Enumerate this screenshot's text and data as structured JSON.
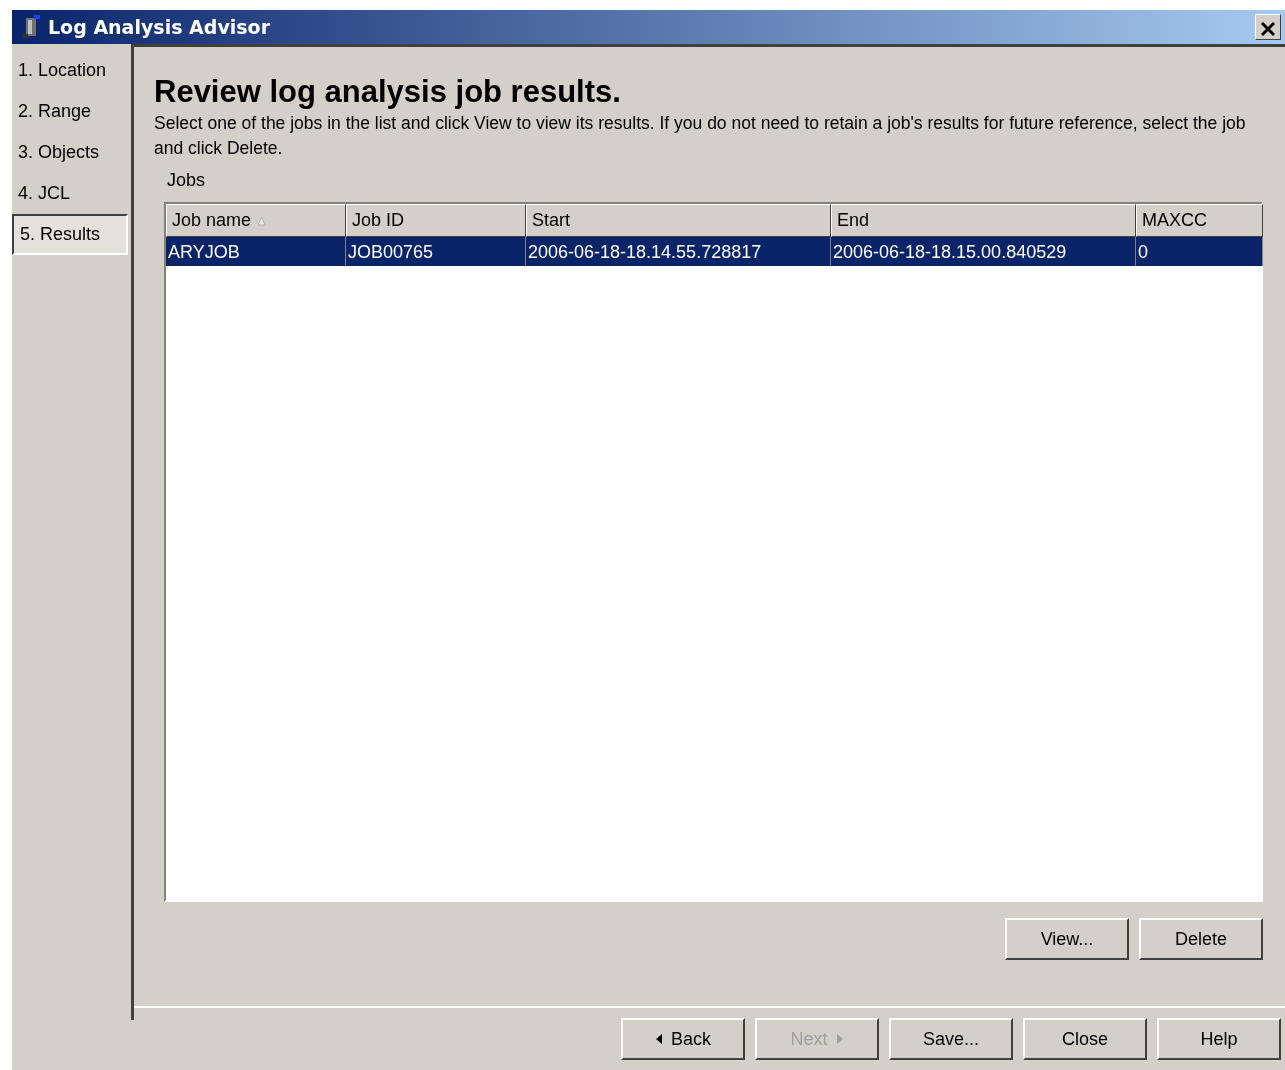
{
  "window": {
    "title": "Log Analysis Advisor"
  },
  "steps": [
    {
      "label": "1. Location",
      "selected": false
    },
    {
      "label": "2. Range",
      "selected": false
    },
    {
      "label": "3. Objects",
      "selected": false
    },
    {
      "label": "4. JCL",
      "selected": false
    },
    {
      "label": "5. Results",
      "selected": true
    }
  ],
  "heading": "Review log analysis job results.",
  "description": "Select one of the jobs in the list and click View to view its results. If you do not need to retain a job's results for future reference, select the job and click Delete.",
  "jobs_label": "Jobs",
  "table": {
    "columns": [
      {
        "label": "Job name",
        "sorted": true
      },
      {
        "label": "Job ID",
        "sorted": false
      },
      {
        "label": "Start",
        "sorted": false
      },
      {
        "label": "End",
        "sorted": false
      },
      {
        "label": "MAXCC",
        "sorted": false
      }
    ],
    "rows": [
      {
        "cells": [
          "ARYJOB",
          "JOB00765",
          "2006-06-18-18.14.55.728817",
          "2006-06-18-18.15.00.840529",
          "0"
        ],
        "selected": true
      }
    ]
  },
  "table_buttons": [
    {
      "label": "View...",
      "disabled": false
    },
    {
      "label": "Delete",
      "disabled": false
    }
  ],
  "footer_buttons": [
    {
      "label": "Back",
      "kind": "back",
      "disabled": false
    },
    {
      "label": "Next",
      "kind": "next",
      "disabled": true
    },
    {
      "label": "Save...",
      "kind": "plain",
      "disabled": false
    },
    {
      "label": "Close",
      "kind": "plain",
      "disabled": false
    },
    {
      "label": "Help",
      "kind": "plain",
      "disabled": false
    }
  ]
}
